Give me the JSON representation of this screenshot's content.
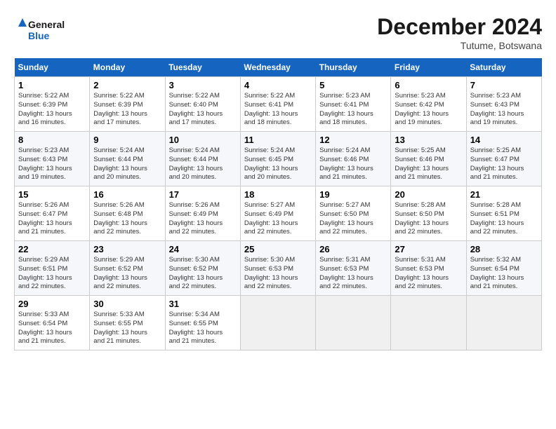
{
  "header": {
    "logo_line1": "General",
    "logo_line2": "Blue",
    "month": "December 2024",
    "location": "Tutume, Botswana"
  },
  "columns": [
    "Sunday",
    "Monday",
    "Tuesday",
    "Wednesday",
    "Thursday",
    "Friday",
    "Saturday"
  ],
  "weeks": [
    [
      {
        "day": "1",
        "info": "Sunrise: 5:22 AM\nSunset: 6:39 PM\nDaylight: 13 hours\nand 16 minutes."
      },
      {
        "day": "2",
        "info": "Sunrise: 5:22 AM\nSunset: 6:39 PM\nDaylight: 13 hours\nand 17 minutes."
      },
      {
        "day": "3",
        "info": "Sunrise: 5:22 AM\nSunset: 6:40 PM\nDaylight: 13 hours\nand 17 minutes."
      },
      {
        "day": "4",
        "info": "Sunrise: 5:22 AM\nSunset: 6:41 PM\nDaylight: 13 hours\nand 18 minutes."
      },
      {
        "day": "5",
        "info": "Sunrise: 5:23 AM\nSunset: 6:41 PM\nDaylight: 13 hours\nand 18 minutes."
      },
      {
        "day": "6",
        "info": "Sunrise: 5:23 AM\nSunset: 6:42 PM\nDaylight: 13 hours\nand 19 minutes."
      },
      {
        "day": "7",
        "info": "Sunrise: 5:23 AM\nSunset: 6:43 PM\nDaylight: 13 hours\nand 19 minutes."
      }
    ],
    [
      {
        "day": "8",
        "info": "Sunrise: 5:23 AM\nSunset: 6:43 PM\nDaylight: 13 hours\nand 19 minutes."
      },
      {
        "day": "9",
        "info": "Sunrise: 5:24 AM\nSunset: 6:44 PM\nDaylight: 13 hours\nand 20 minutes."
      },
      {
        "day": "10",
        "info": "Sunrise: 5:24 AM\nSunset: 6:44 PM\nDaylight: 13 hours\nand 20 minutes."
      },
      {
        "day": "11",
        "info": "Sunrise: 5:24 AM\nSunset: 6:45 PM\nDaylight: 13 hours\nand 20 minutes."
      },
      {
        "day": "12",
        "info": "Sunrise: 5:24 AM\nSunset: 6:46 PM\nDaylight: 13 hours\nand 21 minutes."
      },
      {
        "day": "13",
        "info": "Sunrise: 5:25 AM\nSunset: 6:46 PM\nDaylight: 13 hours\nand 21 minutes."
      },
      {
        "day": "14",
        "info": "Sunrise: 5:25 AM\nSunset: 6:47 PM\nDaylight: 13 hours\nand 21 minutes."
      }
    ],
    [
      {
        "day": "15",
        "info": "Sunrise: 5:26 AM\nSunset: 6:47 PM\nDaylight: 13 hours\nand 21 minutes."
      },
      {
        "day": "16",
        "info": "Sunrise: 5:26 AM\nSunset: 6:48 PM\nDaylight: 13 hours\nand 22 minutes."
      },
      {
        "day": "17",
        "info": "Sunrise: 5:26 AM\nSunset: 6:49 PM\nDaylight: 13 hours\nand 22 minutes."
      },
      {
        "day": "18",
        "info": "Sunrise: 5:27 AM\nSunset: 6:49 PM\nDaylight: 13 hours\nand 22 minutes."
      },
      {
        "day": "19",
        "info": "Sunrise: 5:27 AM\nSunset: 6:50 PM\nDaylight: 13 hours\nand 22 minutes."
      },
      {
        "day": "20",
        "info": "Sunrise: 5:28 AM\nSunset: 6:50 PM\nDaylight: 13 hours\nand 22 minutes."
      },
      {
        "day": "21",
        "info": "Sunrise: 5:28 AM\nSunset: 6:51 PM\nDaylight: 13 hours\nand 22 minutes."
      }
    ],
    [
      {
        "day": "22",
        "info": "Sunrise: 5:29 AM\nSunset: 6:51 PM\nDaylight: 13 hours\nand 22 minutes."
      },
      {
        "day": "23",
        "info": "Sunrise: 5:29 AM\nSunset: 6:52 PM\nDaylight: 13 hours\nand 22 minutes."
      },
      {
        "day": "24",
        "info": "Sunrise: 5:30 AM\nSunset: 6:52 PM\nDaylight: 13 hours\nand 22 minutes."
      },
      {
        "day": "25",
        "info": "Sunrise: 5:30 AM\nSunset: 6:53 PM\nDaylight: 13 hours\nand 22 minutes."
      },
      {
        "day": "26",
        "info": "Sunrise: 5:31 AM\nSunset: 6:53 PM\nDaylight: 13 hours\nand 22 minutes."
      },
      {
        "day": "27",
        "info": "Sunrise: 5:31 AM\nSunset: 6:53 PM\nDaylight: 13 hours\nand 22 minutes."
      },
      {
        "day": "28",
        "info": "Sunrise: 5:32 AM\nSunset: 6:54 PM\nDaylight: 13 hours\nand 21 minutes."
      }
    ],
    [
      {
        "day": "29",
        "info": "Sunrise: 5:33 AM\nSunset: 6:54 PM\nDaylight: 13 hours\nand 21 minutes."
      },
      {
        "day": "30",
        "info": "Sunrise: 5:33 AM\nSunset: 6:55 PM\nDaylight: 13 hours\nand 21 minutes."
      },
      {
        "day": "31",
        "info": "Sunrise: 5:34 AM\nSunset: 6:55 PM\nDaylight: 13 hours\nand 21 minutes."
      },
      null,
      null,
      null,
      null
    ]
  ]
}
